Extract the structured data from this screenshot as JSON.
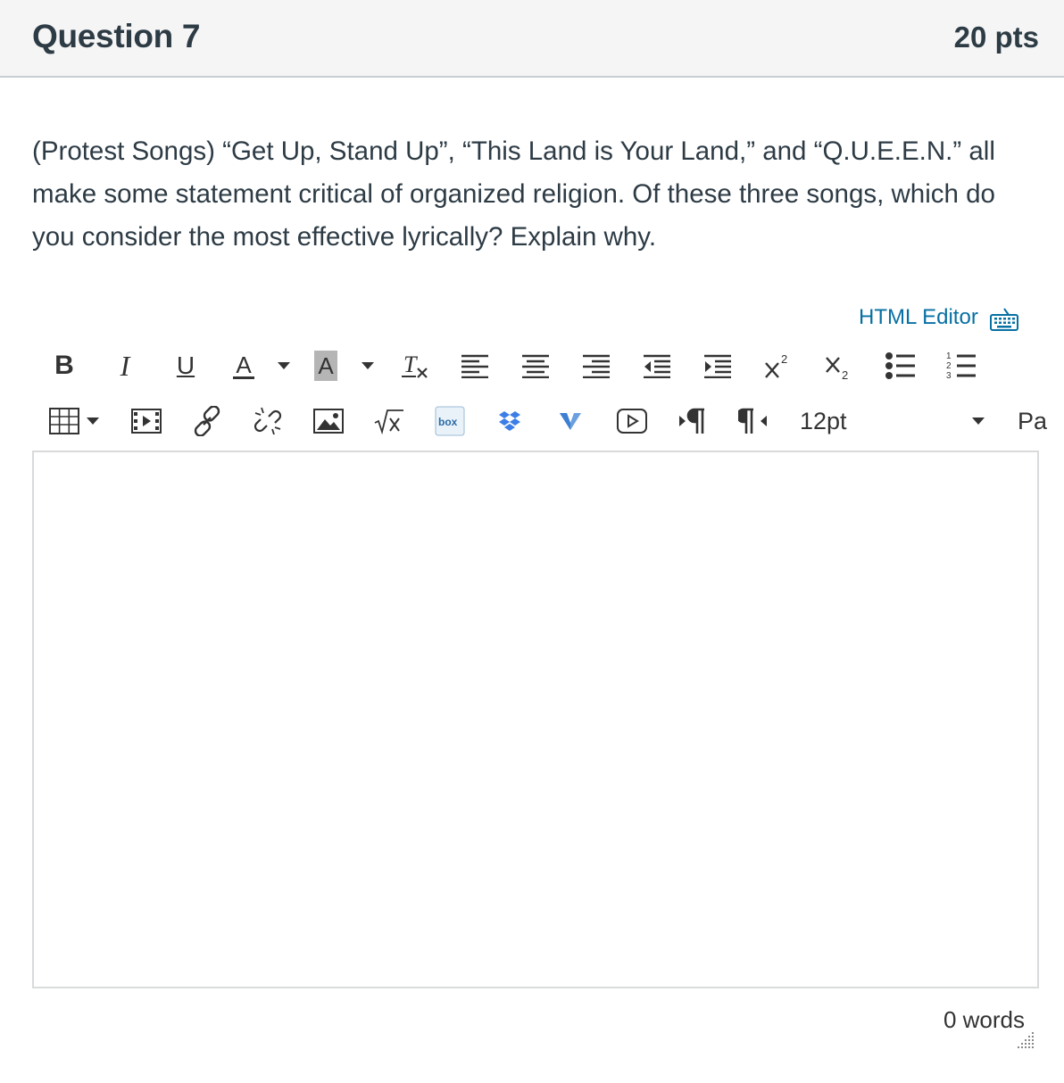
{
  "question": {
    "title": "Question 7",
    "points": "20 pts",
    "text": "(Protest Songs) “Get Up, Stand Up”, “This Land is Your Land,” and “Q.U.E.E.N.” all make some statement critical of organized religion. Of these three songs, which do you consider the most effective lyrically? Explain why."
  },
  "editor": {
    "html_editor_label": "HTML Editor",
    "toolbar_row1": {
      "bold": "B",
      "italic": "I",
      "underline": "U",
      "text_color": "A",
      "background_color": "A"
    },
    "toolbar_row2": {
      "font_size": "12pt",
      "paragraph_format": "Pa"
    },
    "word_count": "0 words"
  },
  "colors": {
    "link": "#0770a3",
    "header_bg": "#f5f5f5",
    "text": "#2d3b45"
  }
}
